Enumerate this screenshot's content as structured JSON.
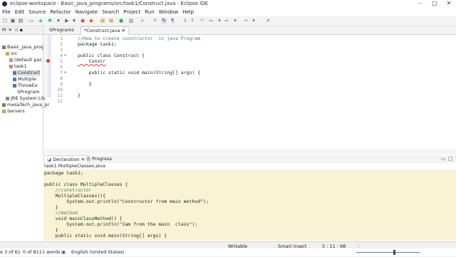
{
  "window": {
    "title": "eclipse-workspace - Basic_java_programs/src/task1/Construct.java - Eclipse IDE"
  },
  "menu": [
    "File",
    "Edit",
    "Source",
    "Refactor",
    "Navigate",
    "Search",
    "Project",
    "Run",
    "Window",
    "Help"
  ],
  "explorer": {
    "tab_label": "Pr",
    "items": [
      "Basic_java_progra",
      "src",
      "(default pac",
      "task1",
      "Construct",
      "Multiple",
      "ThrowEx",
      "SProgram",
      "JRE System Lib",
      "mesaTech_java_pr",
      "Servers"
    ]
  },
  "editor": {
    "tabs": [
      "SPrograms",
      "*Construct.java"
    ],
    "line_numbers": [
      "1",
      "2",
      "3",
      "4",
      "5",
      "6",
      "7",
      "8",
      "9",
      "10",
      "11",
      "12"
    ],
    "lines": [
      "//How to create constructor  in java Program",
      "package task1;",
      "",
      "public class Construct {",
      "    Constr",
      "",
      "    public static void main(String[] args) {",
      "",
      "    }",
      "",
      "}",
      ""
    ]
  },
  "bottom_panel": {
    "tabs": [
      "Declaration",
      "Progress"
    ],
    "path": "task1.MultipleClasses.java",
    "lines": [
      "package task1;",
      "",
      "public class MultipleClasses {",
      "    //constructor",
      "    MultipleClasses(){",
      "        System.out.println(\"Constructor from main method\");",
      "    }",
      "    //method",
      "    void mainClassMethod() {",
      "        System.out.println(\"Iam from the main  class\");",
      "    }",
      "    public static void main(String[] args) {"
    ]
  },
  "status": {
    "left": "e 3 of 61",
    "words": "0 of 8111 words",
    "language": "English (United States)",
    "mode": "Writable",
    "insert": "Smart Insert",
    "position": "5 : 11 : 98"
  },
  "colors": {
    "keyword": "#7f0055",
    "comment": "#3f7f5f",
    "string": "#2a00ff",
    "decl_bg": "#f8f3d4"
  }
}
